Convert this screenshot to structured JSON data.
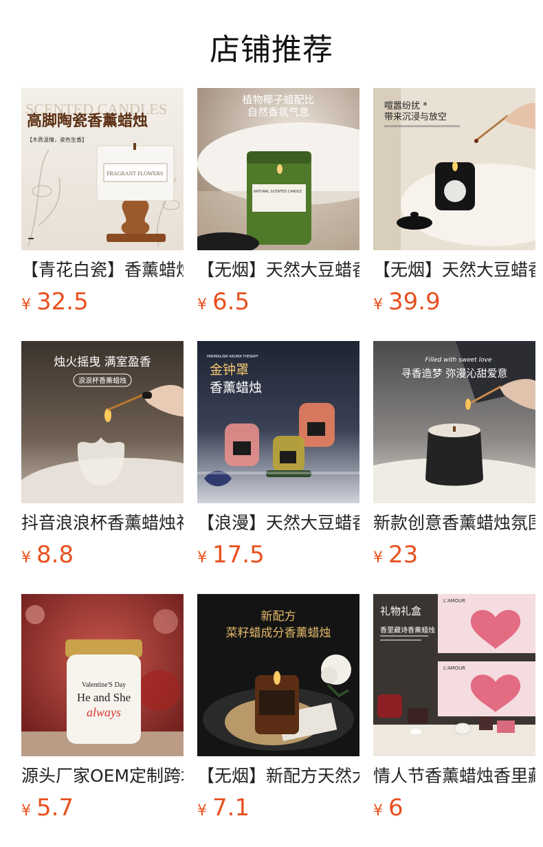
{
  "page": {
    "title": "店铺推荐"
  },
  "products": [
    {
      "name": "【青花白瓷】香薰蜡烛",
      "currency": "¥",
      "price": "32.5",
      "img": {
        "line1": "SCENTED CANDLES",
        "line2": "高脚陶瓷香薰蜡烛",
        "line3": "【木质温情，瓷色生香】",
        "label": "FRAGRANT FLOWERS"
      }
    },
    {
      "name": "【无烟】天然大豆蜡香",
      "currency": "¥",
      "price": "6.5",
      "img": {
        "line1": "植物椰子蜡配比",
        "line2": "自然香氛气息",
        "label": "NATURAL SCENTED CANDLE"
      }
    },
    {
      "name": "【无烟】天然大豆蜡香",
      "currency": "¥",
      "price": "39.9",
      "img": {
        "line1": "喧嚣纷扰 *",
        "line2": "带来沉浸与放空"
      }
    },
    {
      "name": "抖音浪浪杯香薰蜡烛礼",
      "currency": "¥",
      "price": "8.8",
      "img": {
        "line1": "烛火摇曳  满室盈香",
        "line2": "浪浪杯香薰蜡烛"
      }
    },
    {
      "name": "【浪漫】天然大豆蜡香",
      "currency": "¥",
      "price": "17.5",
      "img": {
        "line0": "MINIMALISM AROMA THERAPY",
        "line1": "金钟罩",
        "line2": "香薰蜡烛"
      }
    },
    {
      "name": "新款创意香薰蜡烛氛围",
      "currency": "¥",
      "price": "23",
      "img": {
        "line1": "Filled with sweet love",
        "line2": "寻香造梦  弥漫沁甜爱意"
      }
    },
    {
      "name": "源头厂家OEM定制跨境",
      "currency": "¥",
      "price": "5.7",
      "img": {
        "line1": "Valentine'S Day",
        "line2": "He and She",
        "line3": "always"
      }
    },
    {
      "name": "【无烟】新配方天然大",
      "currency": "¥",
      "price": "7.1",
      "img": {
        "line1": "新配方",
        "line2": "菜籽蜡成分香薰蜡烛"
      }
    },
    {
      "name": "情人节香薰蜡烛香里藏",
      "currency": "¥",
      "price": "6",
      "img": {
        "line1": "礼物礼盒",
        "line2": "香里藏诗香薰蜡烛",
        "label": "L'AMOUR"
      }
    }
  ]
}
